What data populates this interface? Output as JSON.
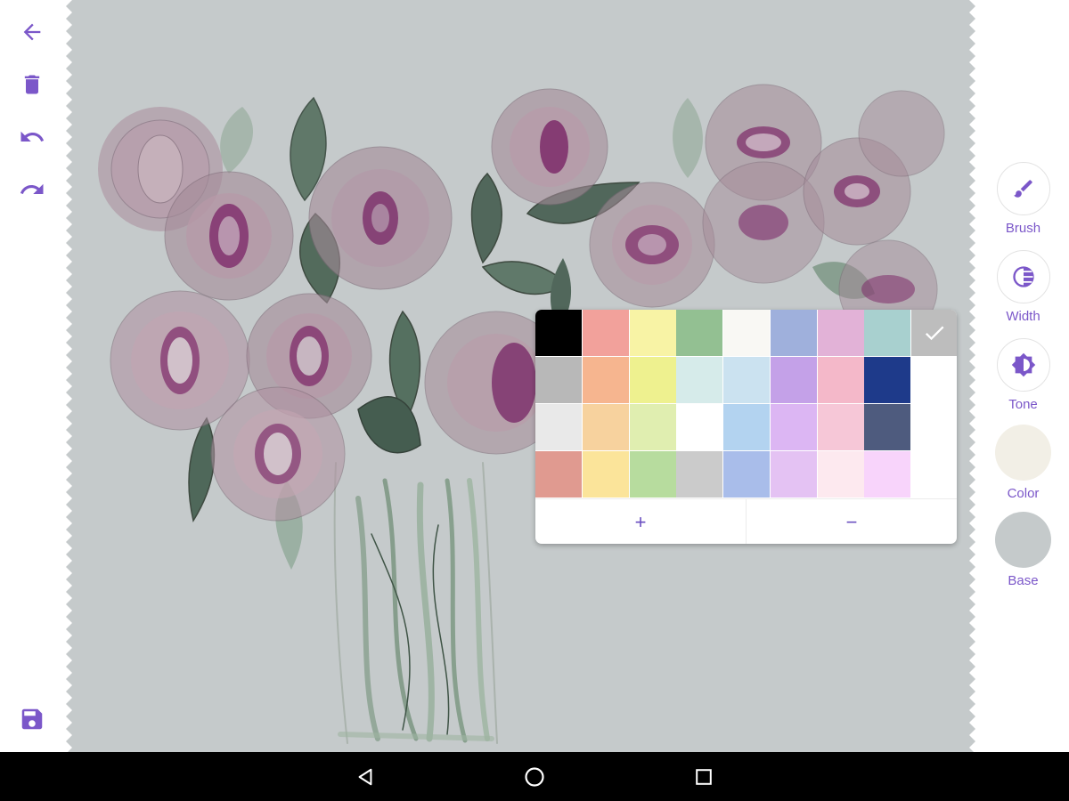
{
  "colors": {
    "accent": "#7b57c9",
    "canvas_bg": "#c5cacb",
    "nav_bar": "#000000"
  },
  "left_toolbar": {
    "items": [
      {
        "name": "back",
        "icon": "arrow-left-icon"
      },
      {
        "name": "delete",
        "icon": "trash-icon"
      },
      {
        "name": "undo",
        "icon": "undo-icon"
      },
      {
        "name": "redo",
        "icon": "redo-icon"
      },
      {
        "name": "save",
        "icon": "save-icon"
      }
    ]
  },
  "right_panel": {
    "brush": {
      "label": "Brush",
      "icon": "brush-icon"
    },
    "width": {
      "label": "Width",
      "icon": "width-icon"
    },
    "tone": {
      "label": "Tone",
      "icon": "tone-icon"
    },
    "color": {
      "label": "Color",
      "value": "#f2efe6"
    },
    "base": {
      "label": "Base",
      "value": "#c5cacb"
    }
  },
  "palette": {
    "rows": [
      [
        "#000000",
        "#f2a19b",
        "#f8f3a5",
        "#93c092",
        "#f9f8f4",
        "#9fb0dc",
        "#e2b2d7",
        "#a8d0cf"
      ],
      [
        "#b8b8b8",
        "#f6b58f",
        "#eef18f",
        "#d6ebea",
        "#cbe2f0",
        "#c4a1e8",
        "#f4b8c9",
        "#1e3a8a"
      ],
      [
        "#e9e9e9",
        "#f7d29e",
        "#e0eeb0",
        "#ffffff",
        "#b3d3f0",
        "#dcb6f3",
        "#f6c7d7",
        "#4e5b7e"
      ],
      [
        "#e09a90",
        "#fbe49a",
        "#b7dc9e",
        "#cbcbcb",
        "#a9bdea",
        "#e4c2f3",
        "#fde9ef",
        "#f8d4fb"
      ]
    ],
    "plus_label": "+",
    "minus_label": "−"
  },
  "nav_bar": {
    "items": [
      {
        "name": "back",
        "icon": "nav-back-icon"
      },
      {
        "name": "home",
        "icon": "nav-home-icon"
      },
      {
        "name": "recents",
        "icon": "nav-recents-icon"
      }
    ]
  }
}
